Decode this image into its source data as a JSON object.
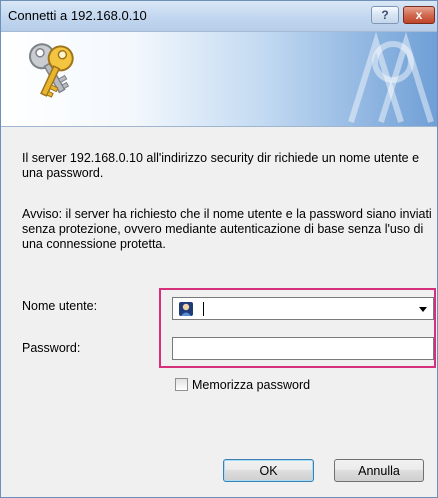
{
  "window": {
    "title": "Connetti a 192.168.0.10",
    "help_glyph": "?",
    "close_glyph": "x"
  },
  "banner": {
    "icon": "keys-icon",
    "art": "decorative-pattern"
  },
  "message": "Il server 192.168.0.10  all'indirizzo security dir richiede un nome utente e una password.",
  "warning": "Avviso: il server ha richiesto che il nome utente e la password siano inviati senza protezione, ovvero mediante autenticazione di base senza l'uso di una connessione protetta.",
  "form": {
    "username_label": "Nome utente:",
    "username_value": "",
    "username_icon": "user-icon",
    "password_label": "Password:",
    "password_value": "",
    "remember_label": "Memorizza password",
    "remember_checked": false,
    "highlight_color": "#d6307c"
  },
  "buttons": {
    "ok": "OK",
    "cancel": "Annulla"
  }
}
